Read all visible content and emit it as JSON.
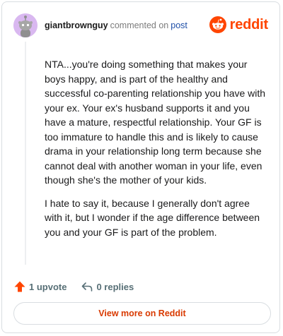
{
  "comment": {
    "author": "giantbrownguy",
    "action_text": "commented on",
    "post_link": "post",
    "avatar_icon": "reddit-snoo-avatar-icon",
    "paragraphs": [
      "NTA...you're doing something that makes your boys happy, and is part of the healthy and successful co-parenting relationship you have with your ex. Your ex's husband supports it and you have a mature, respectful relationship. Your GF is too immature to handle this and is likely to cause drama in your relationship long term because she cannot deal with another woman in your life, even though she's the mother of your kids.",
      "I hate to say it, because I generally don't agree with it, but I wonder if the age difference between you and your GF is part of the problem."
    ]
  },
  "brand": {
    "name": "reddit",
    "icon": "reddit-logo-icon",
    "color": "#ff4500"
  },
  "actions": {
    "upvote_label": "1 upvote",
    "upvote_icon": "upvote-arrow-icon",
    "upvote_color": "#ff4500",
    "replies_label": "0 replies",
    "replies_icon": "reply-arrow-icon"
  },
  "footer": {
    "view_more_label": "View more on Reddit"
  }
}
